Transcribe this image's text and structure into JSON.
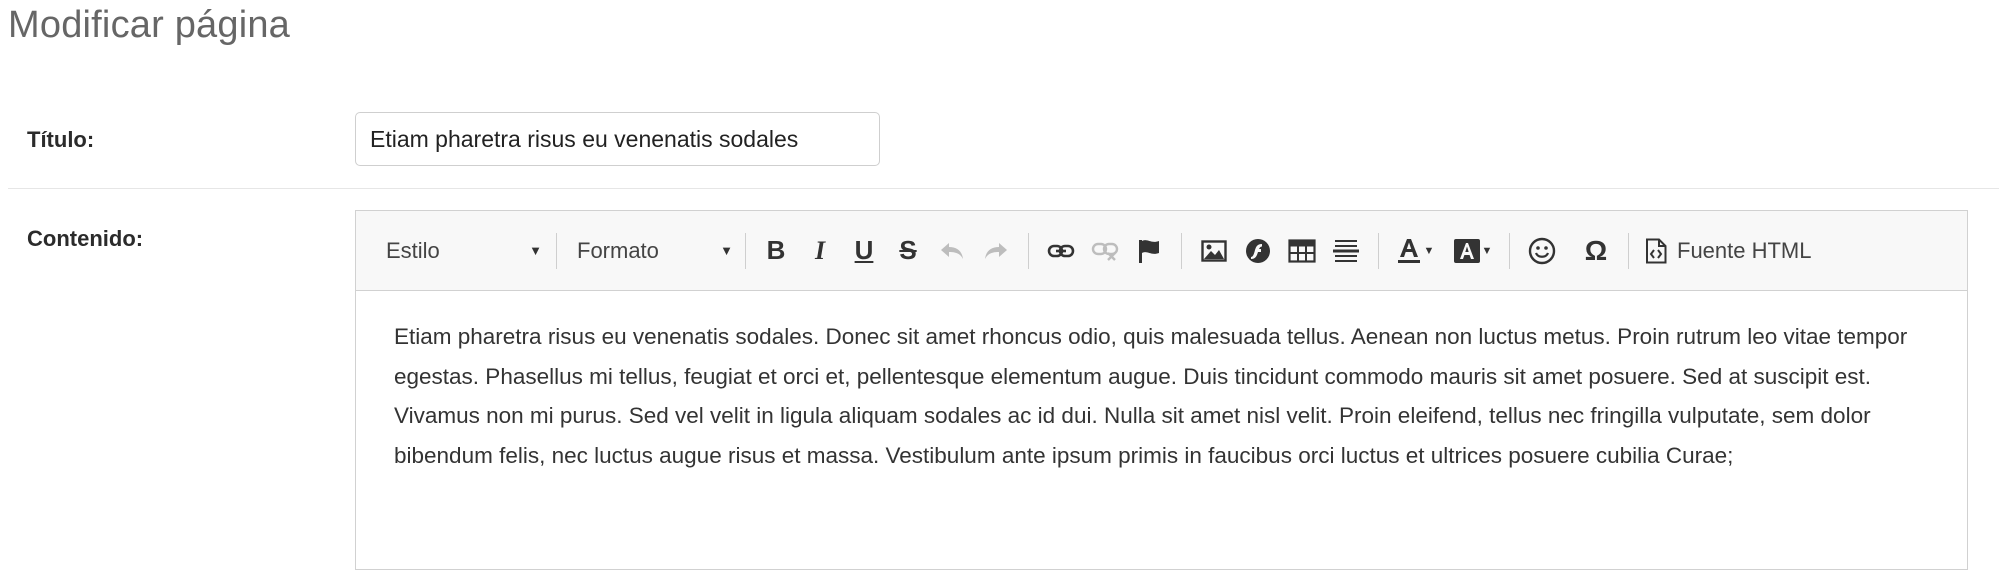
{
  "page": {
    "title": "Modificar página"
  },
  "form": {
    "title_label": "Título:",
    "title_value": "Etiam pharetra risus eu venenatis sodales",
    "content_label": "Contenido:"
  },
  "toolbar": {
    "style_label": "Estilo",
    "format_label": "Formato",
    "source_label": "Fuente HTML",
    "bold_glyph": "B",
    "italic_glyph": "I",
    "underline_glyph": "U",
    "strike_glyph": "S",
    "special_char_glyph": "Ω",
    "smiley_glyph": "☺",
    "icons": [
      "bold-icon",
      "italic-icon",
      "underline-icon",
      "strikethrough-icon",
      "undo-icon",
      "redo-icon",
      "link-icon",
      "unlink-icon",
      "anchor-flag-icon",
      "image-icon",
      "flash-icon",
      "table-icon",
      "horizontal-rule-icon",
      "text-color-icon",
      "background-color-icon",
      "smiley-icon",
      "special-char-icon",
      "source-icon"
    ]
  },
  "editor": {
    "content": "Etiam pharetra risus eu venenatis sodales. Donec sit amet rhoncus odio, quis malesuada tellus. Aenean non luctus metus. Proin rutrum leo vitae tempor egestas. Phasellus mi tellus, feugiat et orci et, pellentesque elementum augue. Duis tincidunt commodo mauris sit amet posuere. Sed at suscipit est. Vivamus non mi purus. Sed vel velit in ligula aliquam sodales ac id dui. Nulla sit amet nisl velit. Proin eleifend, tellus nec fringilla vulputate, sem dolor bibendum felis, nec luctus augue risus et massa. Vestibulum ante ipsum primis in faucibus orci luctus et ultrices posuere cubilia Curae;"
  }
}
